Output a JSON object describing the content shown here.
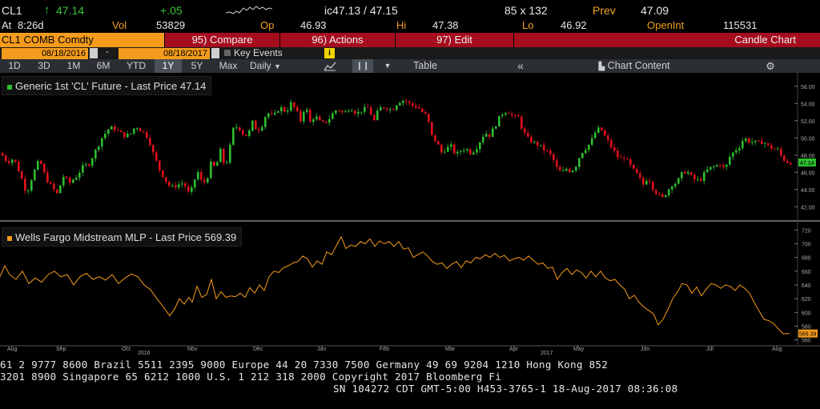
{
  "quote": {
    "ticker": "CL1",
    "arrow": "↑",
    "last": "47.14",
    "change": "+.05",
    "at_label": "At",
    "at_time": "8:26d",
    "vol_label": "Vol",
    "vol": "53829",
    "op_label": "Op",
    "op": "46.93",
    "bid_ask": "ic47.13 / 47.15",
    "size": "85 x 132",
    "prev_label": "Prev",
    "prev": "47.09",
    "hi_label": "Hi",
    "hi": "47.38",
    "lo_label": "Lo",
    "lo": "46.92",
    "openint_label": "OpenInt",
    "openint": "115531"
  },
  "toolbar": {
    "security": "CL1 COMB Comdty",
    "compare": "95) Compare",
    "actions": "96) Actions",
    "edit": "97) Edit",
    "chart_type": "Candle Chart"
  },
  "dates": {
    "start": "08/18/2016",
    "sep": "-",
    "end": "08/18/2017",
    "key_events": "Key Events"
  },
  "periods": [
    "1D",
    "3D",
    "1M",
    "6M",
    "YTD",
    "1Y",
    "5Y",
    "Max"
  ],
  "selected_period": "1Y",
  "frequency": "Daily",
  "table_label": "Table",
  "collapse_label": "«",
  "chart_content_label": "Chart Content",
  "colors": {
    "up": "#2ebd2e",
    "down": "#e0101a",
    "orange": "#f59b1c",
    "red_bar": "#a50d1e"
  },
  "chart_data": [
    {
      "type": "candlestick",
      "legend": "Generic 1st 'CL' Future - Last Price",
      "legend_value": "47.14",
      "last_label": "47.14",
      "ylim": [
        41,
        57
      ],
      "yticks": [
        "56.00",
        "54.00",
        "52.00",
        "50.00",
        "48.00",
        "46.00",
        "44.00",
        "42.00"
      ],
      "close_path": [
        [
          0,
          48.2
        ],
        [
          8,
          47.2
        ],
        [
          16,
          47.6
        ],
        [
          24,
          45.8
        ],
        [
          32,
          43.5
        ],
        [
          40,
          45.8
        ],
        [
          48,
          47.5
        ],
        [
          56,
          45.3
        ],
        [
          64,
          44.2
        ],
        [
          70,
          43.5
        ],
        [
          78,
          45.5
        ],
        [
          86,
          44.8
        ],
        [
          94,
          45.5
        ],
        [
          102,
          46.6
        ],
        [
          110,
          47.0
        ],
        [
          118,
          48.5
        ],
        [
          126,
          50.0
        ],
        [
          134,
          51.0
        ],
        [
          140,
          51.2
        ],
        [
          148,
          50.6
        ],
        [
          156,
          50.2
        ],
        [
          162,
          50.5
        ],
        [
          168,
          51.4
        ],
        [
          176,
          50.8
        ],
        [
          184,
          50.0
        ],
        [
          190,
          48.2
        ],
        [
          198,
          46.3
        ],
        [
          206,
          45.0
        ],
        [
          212,
          44.2
        ],
        [
          220,
          44.5
        ],
        [
          228,
          44.8
        ],
        [
          236,
          43.2
        ],
        [
          240,
          44.8
        ],
        [
          246,
          46.0
        ],
        [
          250,
          45.0
        ],
        [
          256,
          44.8
        ],
        [
          262,
          47.0
        ],
        [
          268,
          46.5
        ],
        [
          274,
          48.5
        ],
        [
          280,
          46.5
        ],
        [
          284,
          48.0
        ],
        [
          290,
          51.0
        ],
        [
          296,
          51.4
        ],
        [
          302,
          50.5
        ],
        [
          308,
          50.2
        ],
        [
          314,
          51.8
        ],
        [
          320,
          50.8
        ],
        [
          326,
          51.5
        ],
        [
          332,
          53.0
        ],
        [
          340,
          52.4
        ],
        [
          348,
          53.6
        ],
        [
          356,
          53.0
        ],
        [
          362,
          54.0
        ],
        [
          368,
          53.3
        ],
        [
          374,
          52.0
        ],
        [
          380,
          53.8
        ],
        [
          386,
          51.8
        ],
        [
          392,
          52.6
        ],
        [
          400,
          51.6
        ],
        [
          408,
          52.0
        ],
        [
          414,
          52.8
        ],
        [
          420,
          53.4
        ],
        [
          428,
          52.8
        ],
        [
          436,
          53.6
        ],
        [
          444,
          52.8
        ],
        [
          450,
          53.2
        ],
        [
          458,
          53.5
        ],
        [
          466,
          52.0
        ],
        [
          472,
          53.4
        ],
        [
          480,
          53.6
        ],
        [
          488,
          53.2
        ],
        [
          496,
          54.2
        ],
        [
          504,
          54.4
        ],
        [
          512,
          53.8
        ],
        [
          520,
          53.6
        ],
        [
          526,
          53.0
        ],
        [
          532,
          52.5
        ],
        [
          538,
          50.2
        ],
        [
          544,
          49.5
        ],
        [
          550,
          48.3
        ],
        [
          556,
          48.8
        ],
        [
          562,
          49.0
        ],
        [
          568,
          48.0
        ],
        [
          574,
          48.5
        ],
        [
          580,
          48.8
        ],
        [
          586,
          48.3
        ],
        [
          592,
          48.6
        ],
        [
          598,
          49.6
        ],
        [
          604,
          50.6
        ],
        [
          610,
          50.3
        ],
        [
          616,
          51.2
        ],
        [
          622,
          52.3
        ],
        [
          628,
          53.1
        ],
        [
          634,
          53.0
        ],
        [
          640,
          52.4
        ],
        [
          646,
          52.4
        ],
        [
          652,
          50.7
        ],
        [
          658,
          49.9
        ],
        [
          664,
          49.5
        ],
        [
          670,
          49.2
        ],
        [
          676,
          48.8
        ],
        [
          682,
          48.4
        ],
        [
          688,
          47.8
        ],
        [
          694,
          46.5
        ],
        [
          700,
          45.9
        ],
        [
          706,
          46.4
        ],
        [
          712,
          46.1
        ],
        [
          718,
          46.8
        ],
        [
          724,
          48.2
        ],
        [
          730,
          48.8
        ],
        [
          736,
          49.4
        ],
        [
          742,
          50.6
        ],
        [
          748,
          51.2
        ],
        [
          754,
          50.2
        ],
        [
          760,
          49.3
        ],
        [
          766,
          48.4
        ],
        [
          772,
          47.5
        ],
        [
          778,
          47.8
        ],
        [
          784,
          47.0
        ],
        [
          790,
          46.2
        ],
        [
          796,
          45.5
        ],
        [
          802,
          44.6
        ],
        [
          808,
          45.5
        ],
        [
          814,
          44.2
        ],
        [
          820,
          43.4
        ],
        [
          826,
          43.0
        ],
        [
          832,
          43.8
        ],
        [
          838,
          44.6
        ],
        [
          844,
          44.8
        ],
        [
          850,
          45.8
        ],
        [
          856,
          46.2
        ],
        [
          862,
          45.5
        ],
        [
          868,
          45.0
        ],
        [
          874,
          45.2
        ],
        [
          880,
          46.1
        ],
        [
          886,
          46.5
        ],
        [
          892,
          46.7
        ],
        [
          898,
          47.0
        ],
        [
          904,
          46.3
        ],
        [
          910,
          47.8
        ],
        [
          916,
          48.5
        ],
        [
          922,
          49.0
        ],
        [
          928,
          50.0
        ],
        [
          934,
          49.6
        ],
        [
          940,
          49.5
        ],
        [
          946,
          49.4
        ],
        [
          952,
          49.6
        ],
        [
          958,
          49.0
        ],
        [
          964,
          48.8
        ],
        [
          970,
          48.6
        ],
        [
          976,
          47.6
        ],
        [
          982,
          47.2
        ],
        [
          986,
          47.14
        ]
      ]
    },
    {
      "type": "line",
      "legend": "Wells Fargo Midstream MLP - Last Price",
      "legend_value": "569.39",
      "last_label": "569.39",
      "ylim": [
        555,
        725
      ],
      "yticks": [
        "720",
        "700",
        "680",
        "660",
        "640",
        "620",
        "600",
        "580",
        "560"
      ],
      "line": [
        [
          0,
          652
        ],
        [
          6,
          668
        ],
        [
          12,
          655
        ],
        [
          20,
          648
        ],
        [
          28,
          660
        ],
        [
          36,
          642
        ],
        [
          44,
          650
        ],
        [
          52,
          644
        ],
        [
          60,
          655
        ],
        [
          68,
          660
        ],
        [
          76,
          652
        ],
        [
          84,
          655
        ],
        [
          92,
          640
        ],
        [
          100,
          652
        ],
        [
          108,
          657
        ],
        [
          116,
          648
        ],
        [
          124,
          652
        ],
        [
          132,
          647
        ],
        [
          140,
          655
        ],
        [
          148,
          642
        ],
        [
          156,
          650
        ],
        [
          164,
          656
        ],
        [
          172,
          652
        ],
        [
          180,
          640
        ],
        [
          188,
          633
        ],
        [
          196,
          620
        ],
        [
          204,
          608
        ],
        [
          212,
          595
        ],
        [
          218,
          605
        ],
        [
          224,
          620
        ],
        [
          230,
          612
        ],
        [
          236,
          622
        ],
        [
          240,
          615
        ],
        [
          246,
          638
        ],
        [
          252,
          622
        ],
        [
          258,
          626
        ],
        [
          264,
          648
        ],
        [
          270,
          620
        ],
        [
          276,
          630
        ],
        [
          282,
          622
        ],
        [
          288,
          624
        ],
        [
          294,
          623
        ],
        [
          300,
          628
        ],
        [
          306,
          622
        ],
        [
          312,
          636
        ],
        [
          318,
          628
        ],
        [
          324,
          640
        ],
        [
          330,
          632
        ],
        [
          336,
          652
        ],
        [
          342,
          660
        ],
        [
          348,
          658
        ],
        [
          354,
          665
        ],
        [
          360,
          668
        ],
        [
          366,
          672
        ],
        [
          372,
          674
        ],
        [
          378,
          682
        ],
        [
          384,
          678
        ],
        [
          390,
          666
        ],
        [
          396,
          675
        ],
        [
          402,
          670
        ],
        [
          408,
          688
        ],
        [
          414,
          684
        ],
        [
          420,
          697
        ],
        [
          426,
          710
        ],
        [
          432,
          693
        ],
        [
          438,
          698
        ],
        [
          444,
          696
        ],
        [
          450,
          703
        ],
        [
          456,
          700
        ],
        [
          462,
          707
        ],
        [
          468,
          696
        ],
        [
          474,
          704
        ],
        [
          480,
          700
        ],
        [
          486,
          703
        ],
        [
          492,
          696
        ],
        [
          498,
          703
        ],
        [
          504,
          692
        ],
        [
          510,
          694
        ],
        [
          516,
          680
        ],
        [
          522,
          684
        ],
        [
          528,
          688
        ],
        [
          534,
          682
        ],
        [
          540,
          674
        ],
        [
          546,
          670
        ],
        [
          552,
          672
        ],
        [
          558,
          664
        ],
        [
          564,
          670
        ],
        [
          570,
          674
        ],
        [
          576,
          665
        ],
        [
          582,
          675
        ],
        [
          588,
          672
        ],
        [
          594,
          680
        ],
        [
          600,
          678
        ],
        [
          606,
          684
        ],
        [
          612,
          680
        ],
        [
          618,
          686
        ],
        [
          624,
          680
        ],
        [
          630,
          683
        ],
        [
          636,
          675
        ],
        [
          642,
          678
        ],
        [
          648,
          680
        ],
        [
          654,
          676
        ],
        [
          660,
          682
        ],
        [
          666,
          676
        ],
        [
          672,
          670
        ],
        [
          678,
          672
        ],
        [
          684,
          664
        ],
        [
          690,
          666
        ],
        [
          696,
          648
        ],
        [
          702,
          658
        ],
        [
          708,
          664
        ],
        [
          714,
          655
        ],
        [
          720,
          662
        ],
        [
          726,
          658
        ],
        [
          732,
          650
        ],
        [
          738,
          660
        ],
        [
          744,
          652
        ],
        [
          750,
          660
        ],
        [
          756,
          650
        ],
        [
          762,
          646
        ],
        [
          768,
          648
        ],
        [
          774,
          640
        ],
        [
          780,
          634
        ],
        [
          786,
          620
        ],
        [
          792,
          625
        ],
        [
          798,
          615
        ],
        [
          804,
          608
        ],
        [
          810,
          603
        ],
        [
          816,
          598
        ],
        [
          822,
          582
        ],
        [
          828,
          590
        ],
        [
          834,
          604
        ],
        [
          840,
          620
        ],
        [
          846,
          630
        ],
        [
          852,
          642
        ],
        [
          858,
          640
        ],
        [
          864,
          628
        ],
        [
          870,
          637
        ],
        [
          876,
          624
        ],
        [
          882,
          634
        ],
        [
          888,
          642
        ],
        [
          894,
          640
        ],
        [
          900,
          635
        ],
        [
          906,
          640
        ],
        [
          912,
          638
        ],
        [
          918,
          632
        ],
        [
          924,
          640
        ],
        [
          930,
          635
        ],
        [
          936,
          628
        ],
        [
          942,
          614
        ],
        [
          948,
          602
        ],
        [
          954,
          590
        ],
        [
          960,
          588
        ],
        [
          966,
          584
        ],
        [
          972,
          576
        ],
        [
          978,
          569
        ],
        [
          986,
          569.39
        ]
      ]
    }
  ],
  "x_axis": {
    "months": [
      "Aug",
      "Sep",
      "Oct",
      "Nov",
      "Dec",
      "Jan",
      "Feb",
      "Mar",
      "Apr",
      "May",
      "Jun",
      "Jul",
      "Aug"
    ],
    "years": [
      "2016",
      "2017"
    ]
  },
  "bottom_ticker": {
    "line1": "61 2 9777 8600 Brazil 5511 2395 9000 Europe 44 20 7330 7500 Germany 49 69 9204 1210 Hong Kong 852",
    "line2": " 3201 8900       Singapore 65 6212 1000      U.S. 1 212 318 2000        Copyright 2017 Bloomberg Fi",
    "line3": "SN 104272 CDT  GMT-5:00 H453-3765-1 18-Aug-2017 08:36:08"
  }
}
